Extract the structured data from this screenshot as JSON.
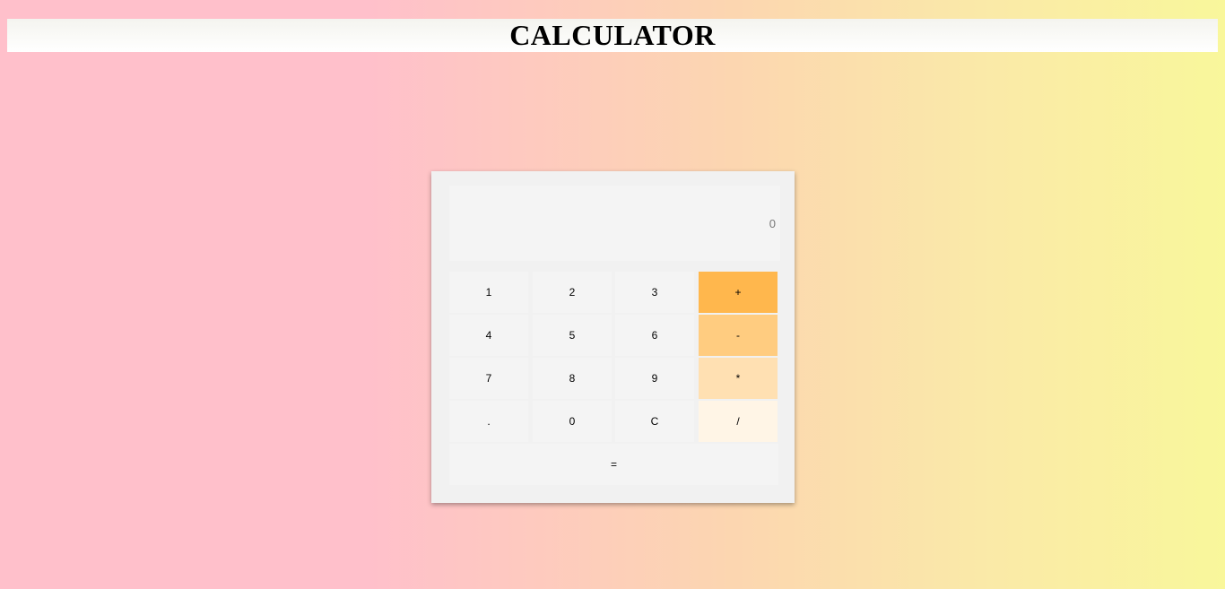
{
  "header": {
    "title": "CALCULATOR"
  },
  "calculator": {
    "display_value": "0",
    "rows": [
      [
        "1",
        "2",
        "3",
        "+"
      ],
      [
        "4",
        "5",
        "6",
        "-"
      ],
      [
        "7",
        "8",
        "9",
        "*"
      ],
      [
        ".",
        "0",
        "C",
        "/"
      ]
    ],
    "equals_label": "=",
    "colors": {
      "plus": "#ffb74d",
      "minus": "#ffcc80",
      "multiply": "#ffe0b2",
      "divide": "#fff5e6",
      "key_bg": "#f4f4f4",
      "panel_bg": "#f1f1f1"
    }
  }
}
